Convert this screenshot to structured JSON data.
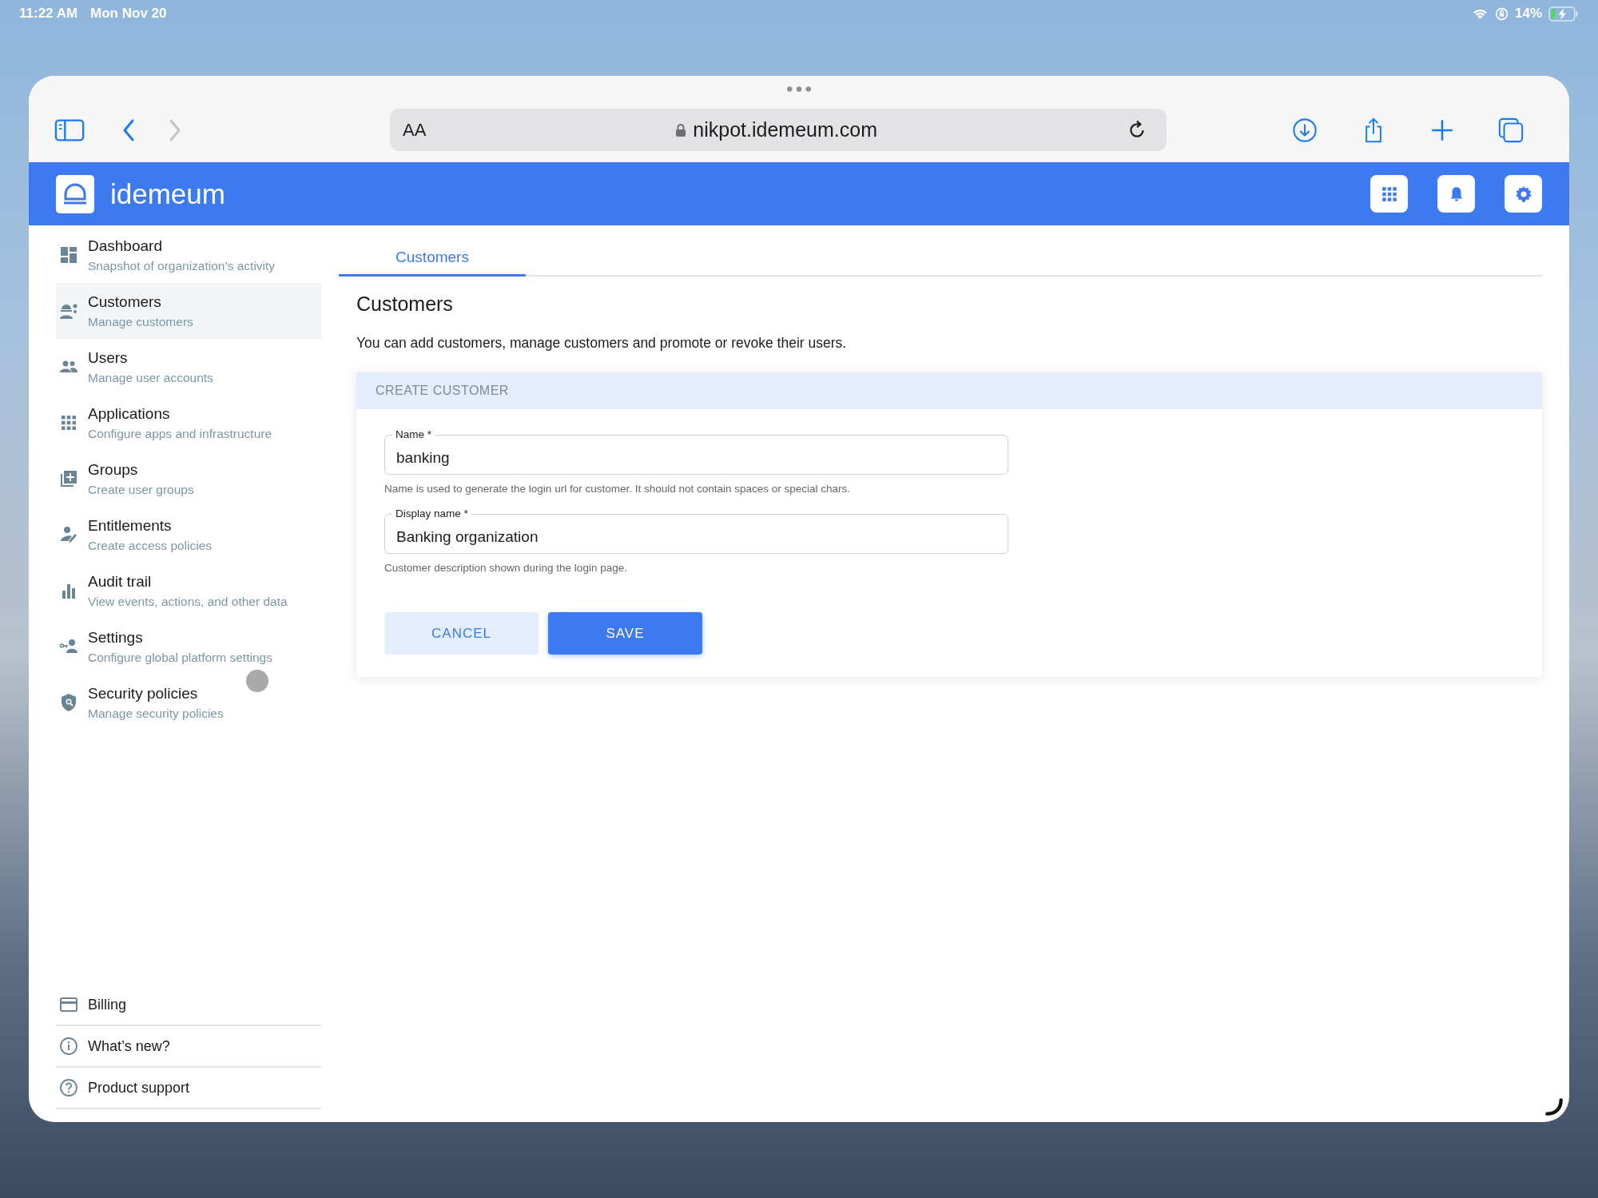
{
  "status_bar": {
    "time": "11:22 AM",
    "date": "Mon Nov 20",
    "battery": "14%"
  },
  "browser": {
    "text_size_button": "AA",
    "url": "nikpot.idemeum.com"
  },
  "app_header": {
    "brand": "idemeum"
  },
  "sidebar": {
    "items": [
      {
        "title": "Dashboard",
        "subtitle": "Snapshot of organization’s activity",
        "selected": false
      },
      {
        "title": "Customers",
        "subtitle": "Manage customers",
        "selected": true
      },
      {
        "title": "Users",
        "subtitle": "Manage user accounts",
        "selected": false
      },
      {
        "title": "Applications",
        "subtitle": "Configure apps and infrastructure",
        "selected": false
      },
      {
        "title": "Groups",
        "subtitle": "Create user groups",
        "selected": false
      },
      {
        "title": "Entitlements",
        "subtitle": "Create access policies",
        "selected": false
      },
      {
        "title": "Audit trail",
        "subtitle": "View events, actions, and other data",
        "selected": false
      },
      {
        "title": "Settings",
        "subtitle": "Configure global platform settings",
        "selected": false
      },
      {
        "title": "Security policies",
        "subtitle": "Manage security policies",
        "selected": false
      }
    ],
    "footer_links": [
      {
        "label": "Billing"
      },
      {
        "label": "What’s new?"
      },
      {
        "label": "Product support"
      }
    ]
  },
  "tabs": [
    {
      "label": "Customers",
      "selected": true
    }
  ],
  "page": {
    "title": "Customers",
    "description": "You can add customers, manage customers and promote or revoke their users."
  },
  "card": {
    "title": "CREATE CUSTOMER",
    "fields": [
      {
        "label": "Name *",
        "value": "banking",
        "helper": "Name is used to generate the login url for customer. It should not contain spaces or special chars."
      },
      {
        "label": "Display name *",
        "value": "Banking organization",
        "helper": "Customer description shown during the login page."
      }
    ],
    "buttons": [
      {
        "label": "CANCEL",
        "kind": "secondary"
      },
      {
        "label": "SAVE",
        "kind": "primary"
      }
    ]
  }
}
